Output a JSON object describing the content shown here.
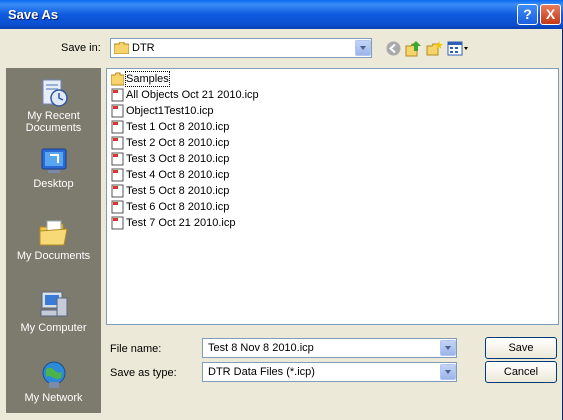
{
  "window": {
    "title": "Save As",
    "help_glyph": "?",
    "close_glyph": "X"
  },
  "toolbar": {
    "save_in_label": "Save in:",
    "save_in_value": "DTR",
    "icons": [
      "back-icon",
      "up-folder-icon",
      "new-folder-icon",
      "views-menu-icon"
    ]
  },
  "places": [
    {
      "label_line1": "My Recent",
      "label_line2": "Documents",
      "icon": "recent-documents-icon"
    },
    {
      "label_line1": "Desktop",
      "label_line2": "",
      "icon": "desktop-icon"
    },
    {
      "label_line1": "My Documents",
      "label_line2": "",
      "icon": "my-documents-icon"
    },
    {
      "label_line1": "My Computer",
      "label_line2": "",
      "icon": "my-computer-icon"
    },
    {
      "label_line1": "My Network",
      "label_line2": "",
      "icon": "my-network-icon"
    }
  ],
  "files": [
    {
      "name": "Samples",
      "type": "folder"
    },
    {
      "name": "All Objects Oct 21 2010.icp",
      "type": "file"
    },
    {
      "name": "Object1Test10.icp",
      "type": "file"
    },
    {
      "name": "Test 1 Oct 8 2010.icp",
      "type": "file"
    },
    {
      "name": "Test 2 Oct 8 2010.icp",
      "type": "file"
    },
    {
      "name": "Test 3 Oct 8 2010.icp",
      "type": "file"
    },
    {
      "name": "Test 4 Oct 8 2010.icp",
      "type": "file"
    },
    {
      "name": "Test 5 Oct 8 2010.icp",
      "type": "file"
    },
    {
      "name": "Test 6 Oct 8 2010.icp",
      "type": "file"
    },
    {
      "name": "Test 7 Oct 21 2010.icp",
      "type": "file"
    }
  ],
  "form": {
    "file_name_label": "File name:",
    "file_name_value": "Test 8 Nov 8 2010.icp",
    "save_as_type_label": "Save as type:",
    "save_as_type_value": "DTR Data Files (*.icp)"
  },
  "buttons": {
    "save": "Save",
    "cancel": "Cancel"
  },
  "colors": {
    "titlebar": "#0a5ae0",
    "dialog_bg": "#ece9d8",
    "places_bg": "#7d7a6e",
    "close": "#d9532f"
  }
}
